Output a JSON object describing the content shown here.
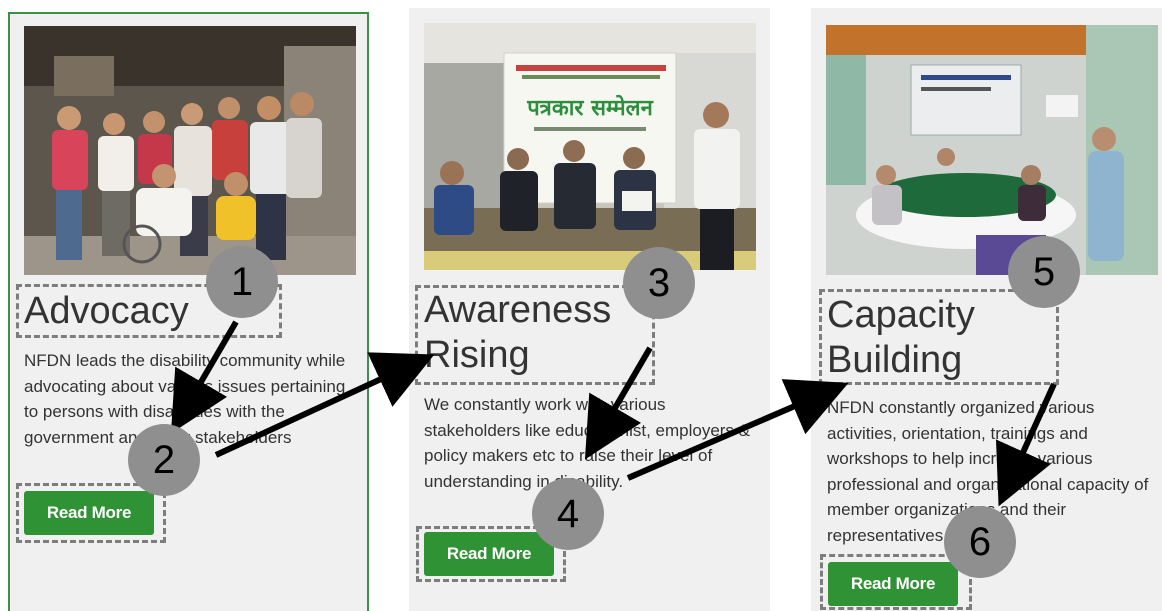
{
  "cards": [
    {
      "title": "Advocacy",
      "description": "NFDN leads the disability community while advocating about various issues pertaining to persons with disabilities with the government and other stakeholders",
      "button_label": "Read More",
      "photo_icon": "group-photo-icon"
    },
    {
      "title": "Awareness Rising",
      "description": "We constantly work with various stakeholders like educationist, employers & policy makers etc to raise their level of understanding in disability.",
      "button_label": "Read More",
      "photo_icon": "press-meet-photo-icon",
      "banner_text": "पत्रकार सम्मेलन"
    },
    {
      "title": "Capacity Building",
      "description": "NFDN constantly organized various activities, orientation, trainings and workshops to help increase various professional and organizational capacity of member organizations and their representatives.",
      "button_label": "Read More",
      "photo_icon": "workshop-photo-icon"
    }
  ],
  "markers": [
    "1",
    "2",
    "3",
    "4",
    "5",
    "6"
  ],
  "colors": {
    "card_bg": "#f0f0f0",
    "button_green": "#2f9234",
    "card_border": "#3e8f4c",
    "marker_grey": "#8f8f8f",
    "dashed_box": "#7d7d7d",
    "text": "#333333"
  }
}
